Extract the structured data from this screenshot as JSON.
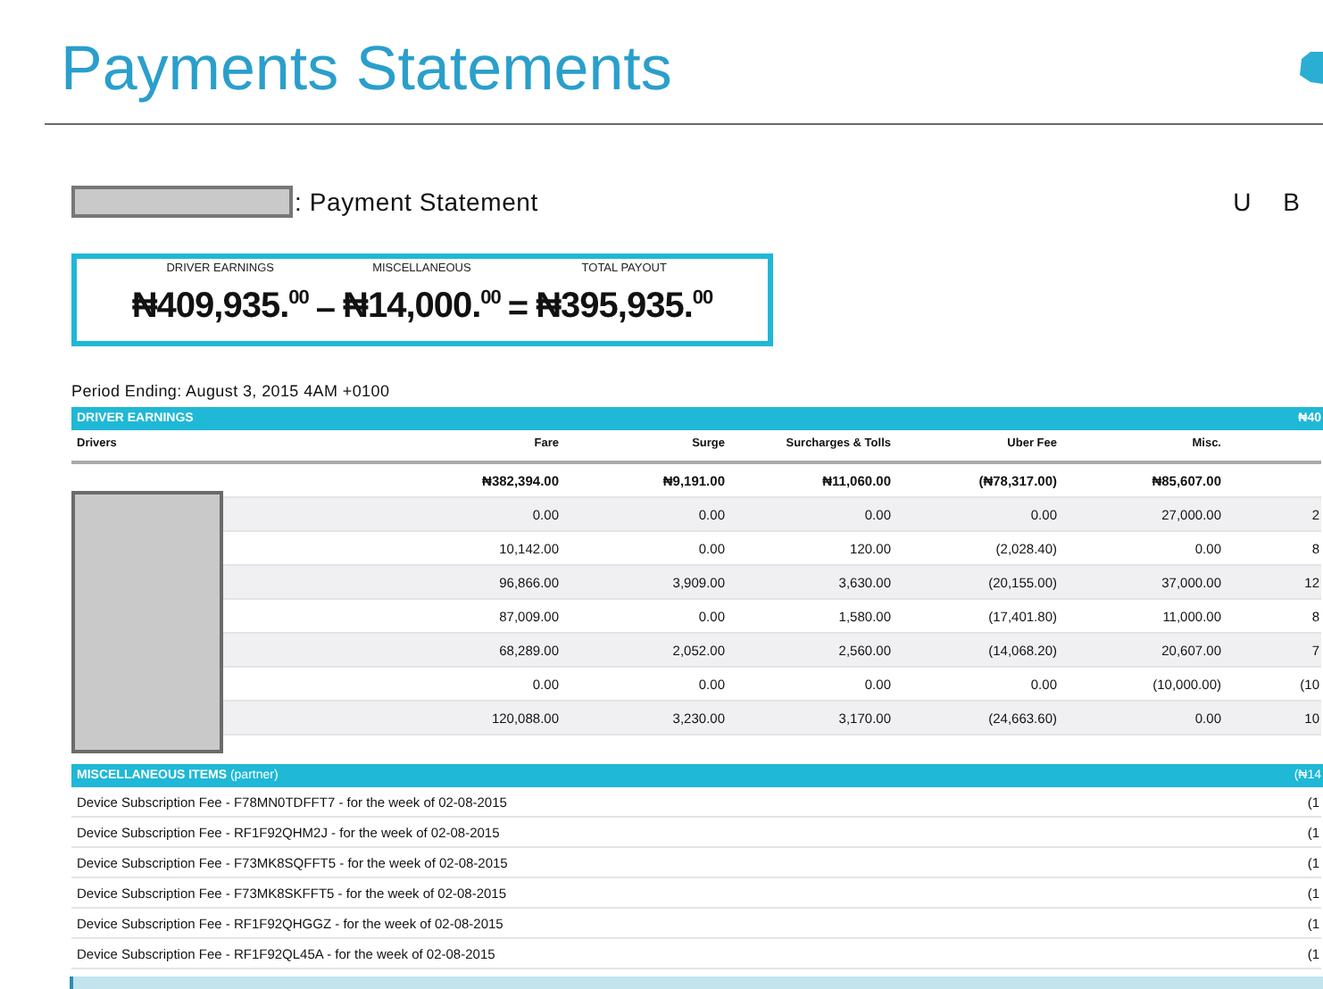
{
  "header": {
    "title": "Payments Statements"
  },
  "statement": {
    "title": ": Payment Statement",
    "brand": "U B"
  },
  "summary": [
    {
      "kind": "figure",
      "label": "DRIVER EARNINGS",
      "amount": "₦409,935.$^{00}$"
    },
    {
      "kind": "operator",
      "text": "–"
    },
    {
      "kind": "figure",
      "label": "MISCELLANEOUS",
      "amount": "₦14,000.$^{00}$"
    },
    {
      "kind": "operator",
      "text": "="
    },
    {
      "kind": "figure",
      "label": "TOTAL PAYOUT",
      "amount": "₦395,935.$^{00}$"
    }
  ],
  "period": "Period Ending: August 3, 2015 4AM +0100",
  "driver_earnings": {
    "title": "DRIVER EARNINGS",
    "total": "₦40",
    "columns": [
      "Drivers",
      "Fare",
      "Surge",
      "Surcharges & Tolls",
      "Uber Fee",
      "Misc."
    ],
    "totals": [
      "₦382,394.00",
      "₦9,191.00",
      "₦11,060.00",
      "(₦78,317.00)",
      "₦85,607.00"
    ],
    "rows": [
      [
        "",
        "0.00",
        "0.00",
        "0.00",
        "0.00",
        "27,000.00",
        "2"
      ],
      [
        "",
        "10,142.00",
        "0.00",
        "120.00",
        "(2,028.40)",
        "0.00",
        "8"
      ],
      [
        "",
        "96,866.00",
        "3,909.00",
        "3,630.00",
        "(20,155.00)",
        "37,000.00",
        "12"
      ],
      [
        "",
        "87,009.00",
        "0.00",
        "1,580.00",
        "(17,401.80)",
        "11,000.00",
        "8"
      ],
      [
        "",
        "68,289.00",
        "2,052.00",
        "2,560.00",
        "(14,068.20)",
        "20,607.00",
        "7"
      ],
      [
        "",
        "0.00",
        "0.00",
        "0.00",
        "0.00",
        "(10,000.00)",
        "(10"
      ],
      [
        "",
        "120,088.00",
        "3,230.00",
        "3,170.00",
        "(24,663.60)",
        "0.00",
        "10"
      ]
    ]
  },
  "misc": {
    "title": "**MISCELLANEOUS ITEMS** (partner)",
    "total": "(₦14",
    "rows": [
      {
        "description": "Device Subscription Fee - F78MN0TDFFT7 - for the week of 02-08-2015",
        "amount": "(1"
      },
      {
        "description": "Device Subscription Fee - RF1F92QHM2J - for the week of 02-08-2015",
        "amount": "(1"
      },
      {
        "description": "Device Subscription Fee - F73MK8SQFFT5 - for the week of 02-08-2015",
        "amount": "(1"
      },
      {
        "description": "Device Subscription Fee - F73MK8SKFFT5 - for the week of 02-08-2015",
        "amount": "(1"
      },
      {
        "description": "Device Subscription Fee - RF1F92QHGGZ - for the week of 02-08-2015",
        "amount": "(1"
      },
      {
        "description": "Device Subscription Fee - RF1F92QL45A - for the week of 02-08-2015",
        "amount": "(1"
      }
    ]
  }
}
